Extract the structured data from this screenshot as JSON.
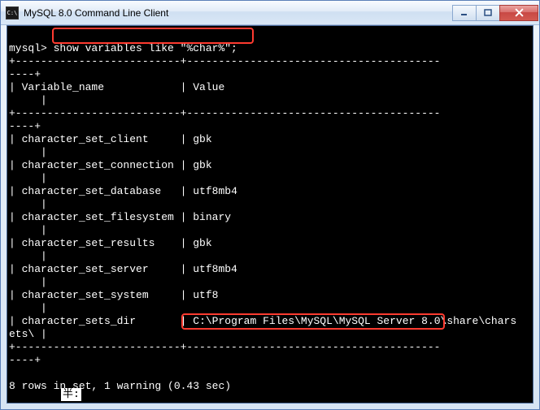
{
  "window": {
    "title": "MySQL 8.0 Command Line Client",
    "app_icon_text": "C:\\"
  },
  "prompt": "mysql>",
  "command": "show variables like \"%char%\";",
  "divider_top": "+--------------------------+----------------------------------------",
  "divider_cont": "----+",
  "header": {
    "col1": "Variable_name",
    "col2": "Value"
  },
  "rows": [
    {
      "name": "character_set_client",
      "value": "gbk"
    },
    {
      "name": "character_set_connection",
      "value": "gbk"
    },
    {
      "name": "character_set_database",
      "value": "utf8mb4"
    },
    {
      "name": "character_set_filesystem",
      "value": "binary"
    },
    {
      "name": "character_set_results",
      "value": "gbk"
    },
    {
      "name": "character_set_server",
      "value": "utf8mb4"
    },
    {
      "name": "character_set_system",
      "value": "utf8"
    }
  ],
  "dir_row": {
    "name": "character_sets_dir",
    "value_part1": "C:\\Program Files\\MySQL\\MySQL Server 8.0",
    "value_part2": "\\share\\chars",
    "wrap": "ets\\ |"
  },
  "row_trailer": "     |",
  "summary": "8 rows in set, 1 warning (0.43 sec)",
  "ime_text": "半:"
}
